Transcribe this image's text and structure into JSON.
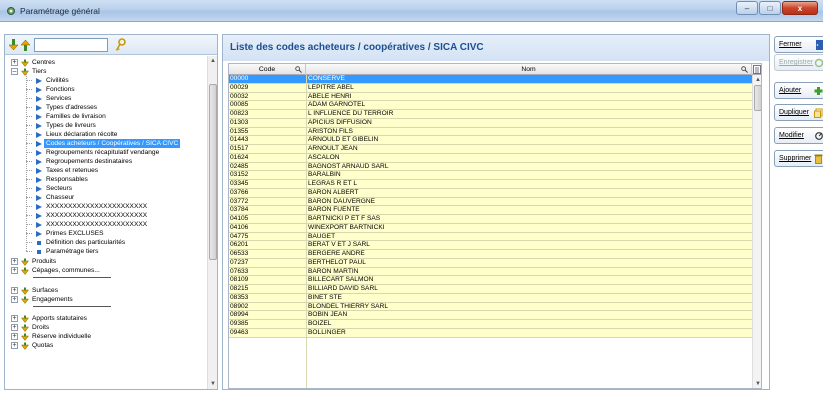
{
  "window": {
    "title": "Paramétrage général",
    "minimize": "–",
    "maximize": "□",
    "close": "x"
  },
  "tree": {
    "search_value": "",
    "items": [
      {
        "label": "Centres",
        "expand": "+",
        "icon": "gold-dots-icon"
      },
      {
        "label": "Tiers",
        "expand": "–",
        "icon": "gold-folder-icon"
      },
      {
        "label": "Civilités",
        "icon": "blue-arrow-icon"
      },
      {
        "label": "Fonctions",
        "icon": "blue-arrow-icon"
      },
      {
        "label": "Services",
        "icon": "blue-arrow-icon"
      },
      {
        "label": "Types d'adresses",
        "icon": "blue-arrow-icon"
      },
      {
        "label": "Familles de livraison",
        "icon": "blue-arrow-icon"
      },
      {
        "label": "Types de livreurs",
        "icon": "blue-arrow-icon"
      },
      {
        "label": "Lieux déclaration récolte",
        "icon": "blue-arrow-icon"
      },
      {
        "label": "Codes acheteurs / Coopératives / SICA CIVC",
        "icon": "blue-arrow-icon"
      },
      {
        "label": "Regroupements récapitulatif vendange",
        "icon": "blue-arrow-icon"
      },
      {
        "label": "Regroupements destinataires",
        "icon": "blue-arrow-icon"
      },
      {
        "label": "Taxes et retenues",
        "icon": "blue-arrow-icon"
      },
      {
        "label": "Responsables",
        "icon": "blue-arrow-icon"
      },
      {
        "label": "Secteurs",
        "icon": "blue-arrow-icon"
      },
      {
        "label": "Chasseur",
        "icon": "blue-arrow-icon"
      },
      {
        "label": "XXXXXXXXXXXXXXXXXXXXXXX",
        "icon": "blue-arrow-icon"
      },
      {
        "label": "XXXXXXXXXXXXXXXXXXXXXXX",
        "icon": "blue-arrow-icon"
      },
      {
        "label": "XXXXXXXXXXXXXXXXXXXXXXX",
        "icon": "blue-arrow-icon"
      },
      {
        "label": "Primes EXCLUSES",
        "icon": "blue-arrow-icon"
      },
      {
        "label": "Définition des particularités",
        "icon": "blue-square-icon"
      },
      {
        "label": "Paramétrage tiers",
        "icon": "blue-square-icon"
      },
      {
        "label": "Produits",
        "expand": "+",
        "icon": "gold-dots-icon"
      },
      {
        "label": "Cépages, communes...",
        "expand": "+",
        "icon": "gold-dots-icon"
      },
      {
        "label": "Surfaces",
        "expand": "+",
        "icon": "gold-dots-icon"
      },
      {
        "label": "Engagements",
        "expand": "+",
        "icon": "gold-dots-icon"
      },
      {
        "label": "Apports statutaires",
        "expand": "+",
        "icon": "gold-dots-icon"
      },
      {
        "label": "Droits",
        "expand": "+",
        "icon": "gold-dots-icon"
      },
      {
        "label": "Réserve individuelle",
        "expand": "+",
        "icon": "gold-dots-icon"
      },
      {
        "label": "Quotas",
        "expand": "+",
        "icon": "gold-dots-icon"
      }
    ]
  },
  "main": {
    "title": "Liste des codes acheteurs / coopératives / SICA CIVC",
    "columns": [
      "Code",
      "Nom"
    ],
    "rows": [
      [
        "00000",
        "CONSERVE"
      ],
      [
        "00029",
        "LEPITRE ABEL"
      ],
      [
        "00032",
        "ABELE HENRI"
      ],
      [
        "00085",
        "ADAM GARNOTEL"
      ],
      [
        "00823",
        "L INFLUENCE DU TERROIR"
      ],
      [
        "01303",
        "APICIUS DIFFUSION"
      ],
      [
        "01355",
        "ARISTON FILS"
      ],
      [
        "01443",
        "ARNOULD ET GIBELIN"
      ],
      [
        "01517",
        "ARNOULT JEAN"
      ],
      [
        "01624",
        "ASCALON"
      ],
      [
        "02485",
        "BAGNOST ARNAUD SARL"
      ],
      [
        "03152",
        "BARALBIN"
      ],
      [
        "03345",
        "LEGRAS R ET L"
      ],
      [
        "03766",
        "BARON ALBERT"
      ],
      [
        "03772",
        "BARON DAUVERGNE"
      ],
      [
        "03784",
        "BARON FUENTE"
      ],
      [
        "04105",
        "BARTNICKI P ET F SAS"
      ],
      [
        "04106",
        "WINEXPORT BARTNICKI"
      ],
      [
        "04775",
        "BAUGET"
      ],
      [
        "06201",
        "BERAT V ET J SARL"
      ],
      [
        "06533",
        "BERGERE ANDRE"
      ],
      [
        "07237",
        "BERTHELOT PAUL"
      ],
      [
        "07633",
        "BARON MARTIN"
      ],
      [
        "08109",
        "BILLECART SALMON"
      ],
      [
        "08215",
        "BILLIARD DAVID SARL"
      ],
      [
        "08353",
        "BINET STE"
      ],
      [
        "08902",
        "BLONDEL THIERRY SARL"
      ],
      [
        "08994",
        "BOBIN JEAN"
      ],
      [
        "09385",
        "BOIZEL"
      ],
      [
        "09463",
        "BOLLINGER"
      ]
    ]
  },
  "actions": {
    "fermer": "Fermer",
    "enregistrer": "Enregistrer",
    "ajouter": "Ajouter",
    "dupliquer": "Dupliquer",
    "modifier": "Modifier",
    "supprimer": "Supprimer"
  },
  "colors": {
    "row_bg": "#ffffcc",
    "selection": "#3399ff",
    "title_text": "#1d4f91"
  }
}
